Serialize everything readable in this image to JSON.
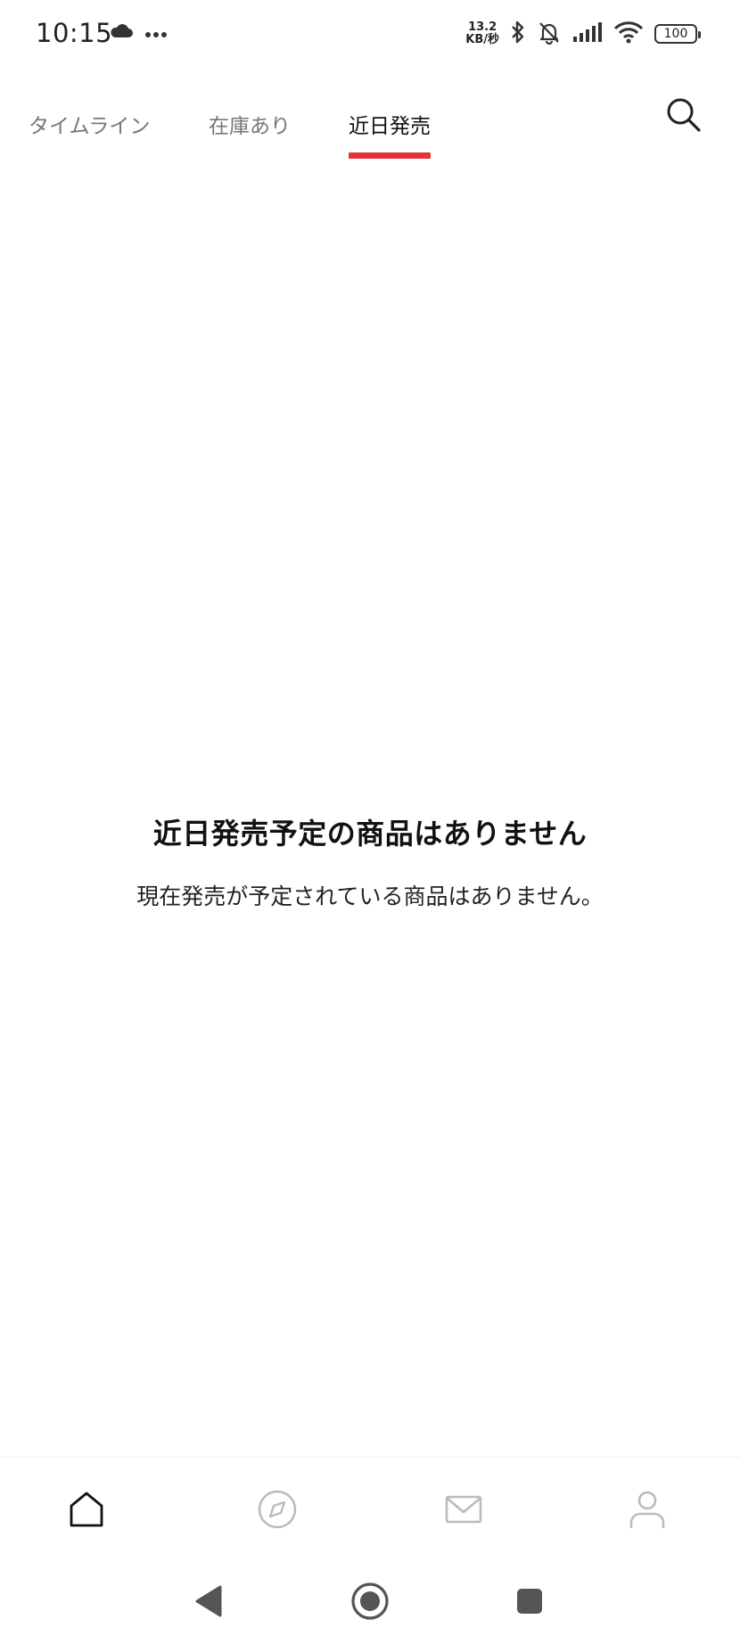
{
  "status_bar": {
    "time": "10:15",
    "net_speed_value": "13.2",
    "net_speed_unit": "KB/秒",
    "battery": "100"
  },
  "tabs": [
    {
      "label": "タイムライン",
      "active": false
    },
    {
      "label": "在庫あり",
      "active": false
    },
    {
      "label": "近日発売",
      "active": true
    }
  ],
  "empty_state": {
    "title": "近日発売予定の商品はありません",
    "description": "現在発売が予定されている商品はありません。"
  },
  "colors": {
    "accent": "#e5333b",
    "active_text": "#111111",
    "inactive_text": "#777777",
    "nav_inactive": "#bbbbbb"
  },
  "icons": {
    "search": "search-icon",
    "home": "home-icon",
    "discover": "compass-icon",
    "messages": "mail-icon",
    "profile": "user-icon"
  }
}
